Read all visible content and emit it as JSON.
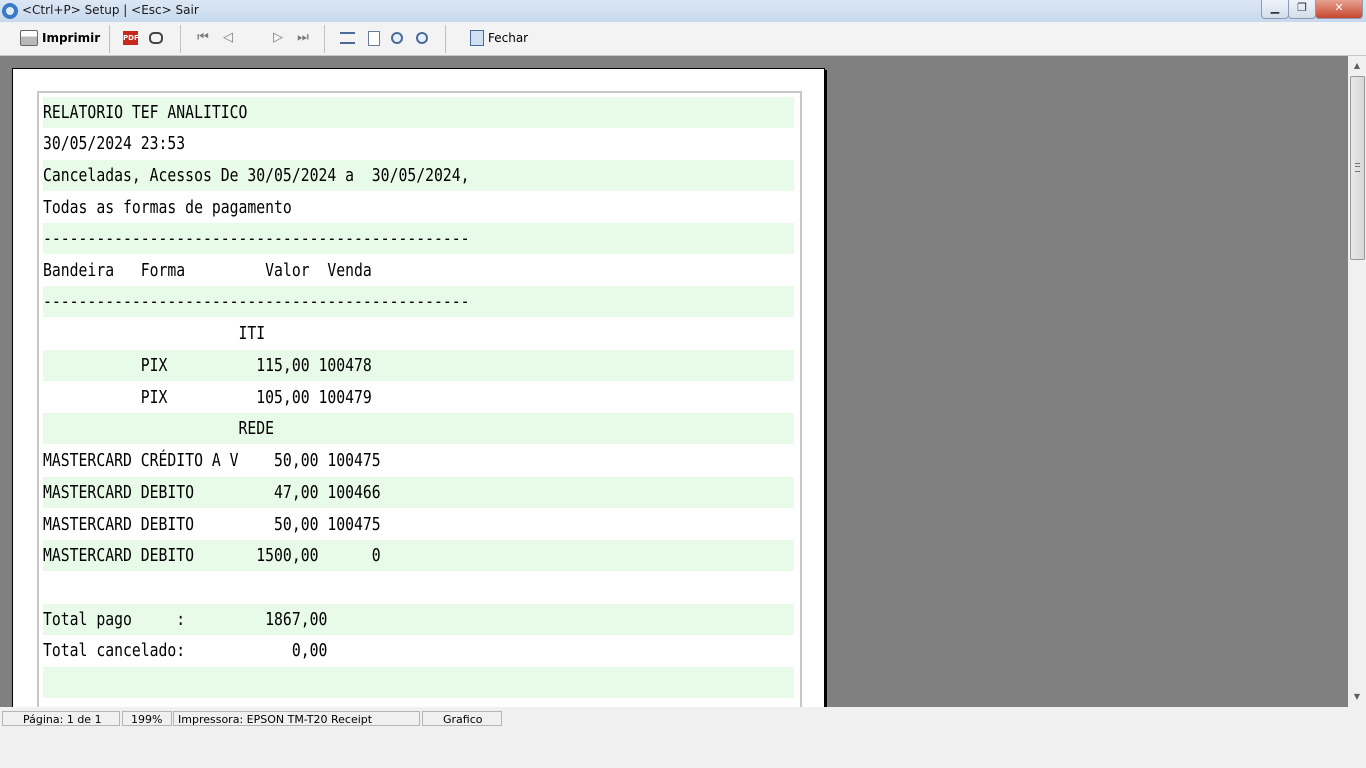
{
  "window": {
    "title": "<Ctrl+P> Setup | <Esc> Sair",
    "min_glyph": "▁",
    "max_glyph": "❐",
    "close_glyph": "✕"
  },
  "toolbar": {
    "print_label": "Imprimir",
    "pdf_text": "PDF",
    "first_glyph": "⏮",
    "prev_glyph": "◁",
    "next_glyph": "▷",
    "last_glyph": "⏭",
    "close_label": "Fechar"
  },
  "report": {
    "lines": [
      "RELATORIO TEF ANALITICO",
      "30/05/2024 23:53",
      "Canceladas, Acessos De 30/05/2024 a  30/05/2024,",
      "Todas as formas de pagamento",
      "------------------------------------------------",
      "Bandeira   Forma         Valor  Venda",
      "------------------------------------------------",
      "                      ITI",
      "           PIX          115,00 100478",
      "           PIX          105,00 100479",
      "                      REDE",
      "MASTERCARD CRÉDITO A V    50,00 100475",
      "MASTERCARD DEBITO         47,00 100466",
      "MASTERCARD DEBITO         50,00 100475",
      "MASTERCARD DEBITO       1500,00      0",
      "",
      "Total pago     :         1867,00",
      "Total cancelado:            0,00",
      ""
    ]
  },
  "scrollbar": {
    "up_glyph": "▲",
    "down_glyph": "▼"
  },
  "status": {
    "page": "Página: 1 de 1",
    "zoom": "199%",
    "printer": "Impressora: EPSON TM-T20 Receipt",
    "mode": "Grafico"
  }
}
